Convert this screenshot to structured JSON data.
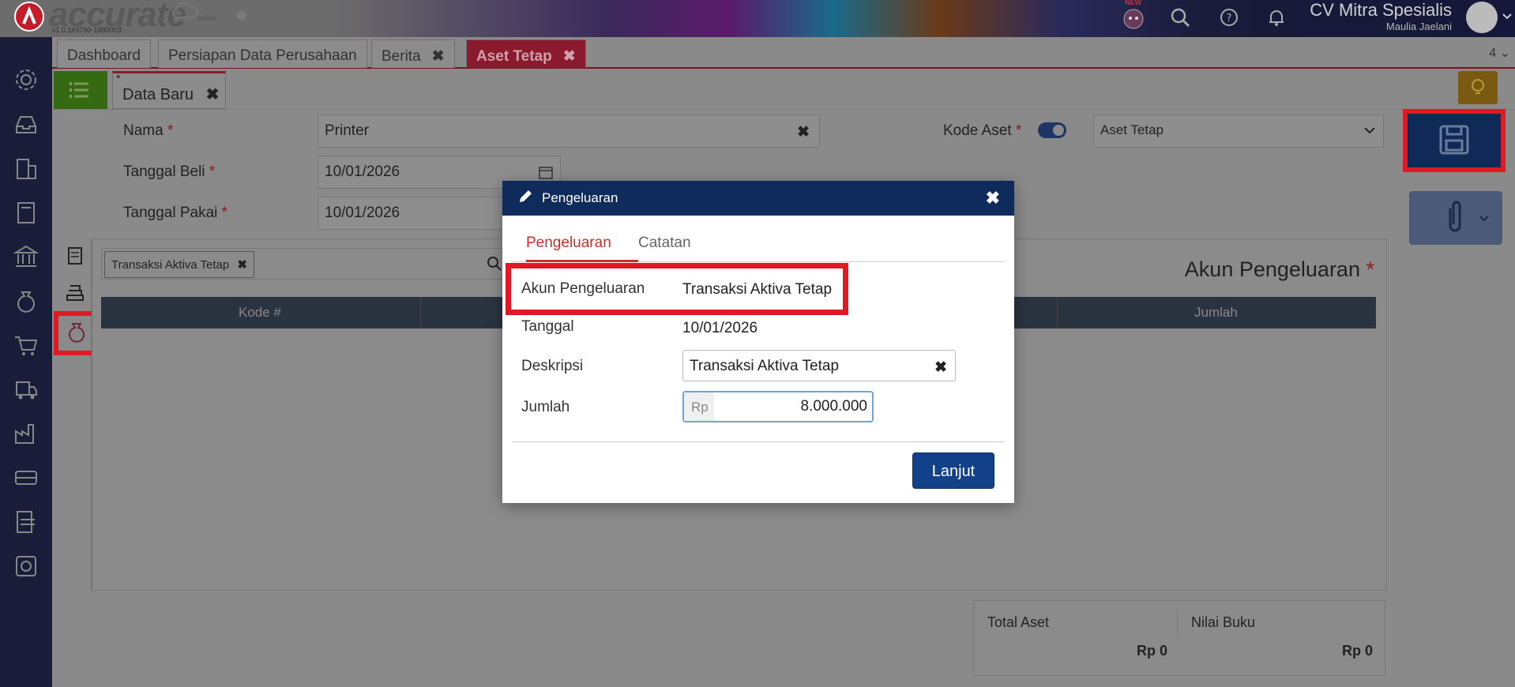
{
  "header": {
    "logo_text": "accurate",
    "logo_sub": "online",
    "version": "v1.0.1#3790-1880003",
    "new_badge": "NEW",
    "company_name": "CV Mitra Spesialis",
    "user_name": "Maulia Jaelani"
  },
  "tabs": [
    {
      "label": "Dashboard"
    },
    {
      "label": "Persiapan Data Perusahaan"
    },
    {
      "label": "Berita",
      "closable": true
    },
    {
      "label": "Aset Tetap",
      "closable": true,
      "active": true
    }
  ],
  "tab_count": "4",
  "close_glyph": "✖",
  "subtab": {
    "star": "*",
    "label": "Data Baru"
  },
  "form": {
    "nama_label": "Nama",
    "nama_value": "Printer",
    "tanggal_beli_label": "Tanggal Beli",
    "tanggal_beli_value": "10/01/2026",
    "tanggal_pakai_label": "Tanggal Pakai",
    "tanggal_pakai_value": "10/01/2026",
    "kode_aset_label": "Kode Aset",
    "kode_aset_value": "Aset Tetap",
    "required_mark": "*"
  },
  "panel": {
    "chip_label": "Transaksi Aktiva Tetap",
    "right_title": "Akun Pengeluaran",
    "columns": [
      "Kode #",
      "Jumlah"
    ]
  },
  "totals": {
    "total_aset_label": "Total Aset",
    "total_aset_value": "Rp 0",
    "nilai_buku_label": "Nilai Buku",
    "nilai_buku_value": "Rp 0"
  },
  "modal": {
    "title": "Pengeluaran",
    "tabs": [
      "Pengeluaran",
      "Catatan"
    ],
    "akun_label": "Akun Pengeluaran",
    "akun_value": "Transaksi Aktiva Tetap",
    "tanggal_label": "Tanggal",
    "tanggal_value": "10/01/2026",
    "deskripsi_label": "Deskripsi",
    "deskripsi_value": "Transaksi Aktiva Tetap",
    "jumlah_label": "Jumlah",
    "currency": "Rp",
    "jumlah_value": "8.000.000",
    "submit_label": "Lanjut"
  },
  "colors": {
    "highlight": "#e01a24",
    "modal_header": "#0f2b5b",
    "primary_button": "#12418a",
    "active_tab": "#8c1a2e",
    "sidebar": "#1a1d3a"
  },
  "icons": {
    "sidebar": [
      "gear-icon",
      "inbox-icon",
      "building-icon",
      "book-icon",
      "bank-icon",
      "money-bag-icon",
      "cart-icon",
      "truck-icon",
      "factory-icon",
      "conveyor-icon",
      "tax-icon",
      "report-icon"
    ]
  }
}
